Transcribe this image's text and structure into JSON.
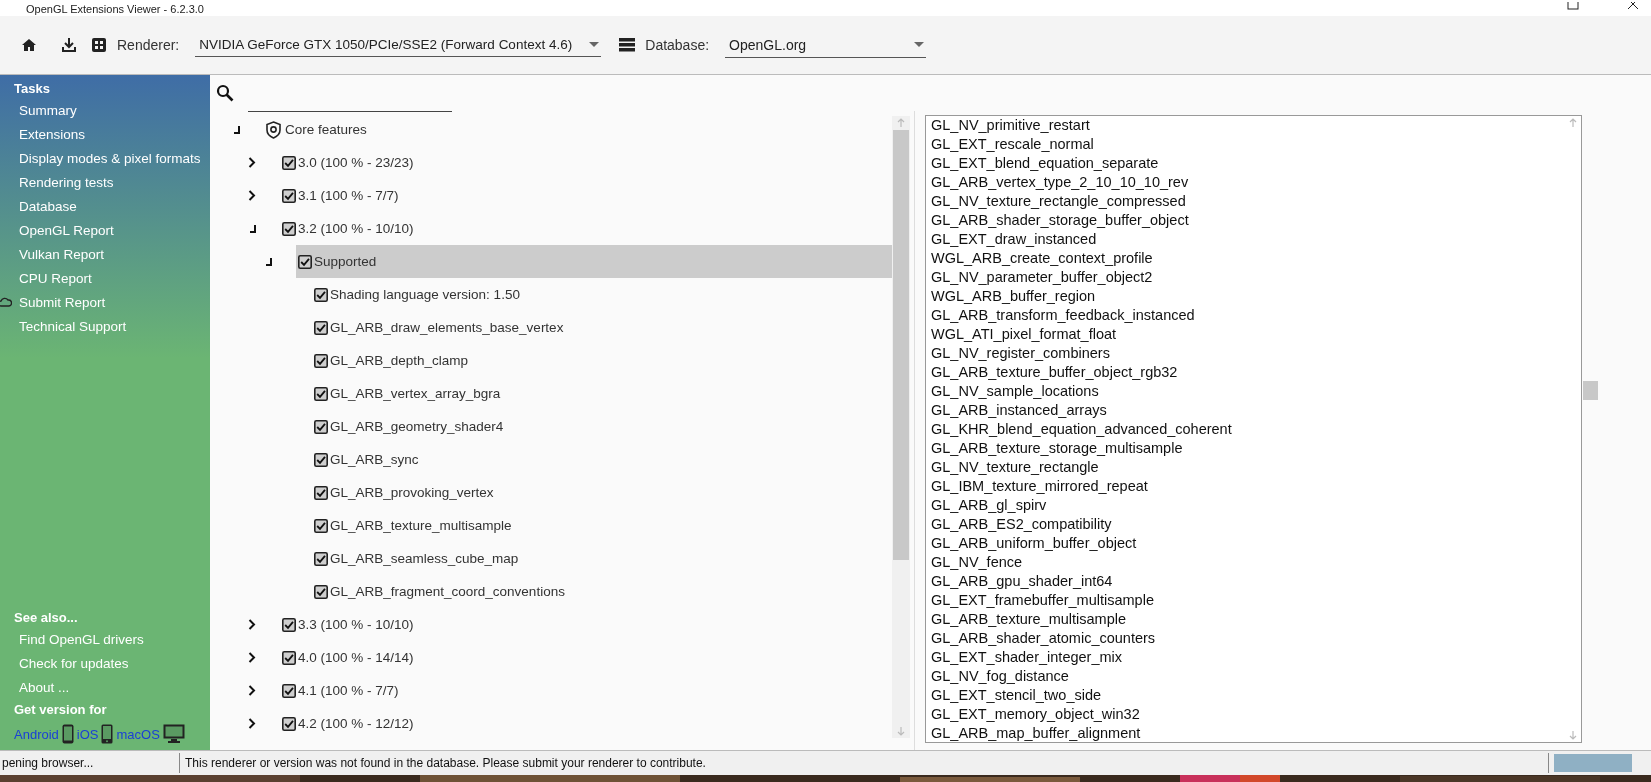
{
  "window": {
    "title": "OpenGL Extensions Viewer - 6.2.3.0"
  },
  "toolbar": {
    "renderer_label": "Renderer:",
    "renderer": "NVIDIA GeForce GTX 1050/PCIe/SSE2 (Forward Context 4.6)",
    "database_label": "Database:",
    "database": "OpenGL.org"
  },
  "sidebar": {
    "tasks_title": "Tasks",
    "tasks": [
      "Summary",
      "Extensions",
      "Display modes & pixel formats",
      "Rendering tests",
      "Database",
      "OpenGL Report",
      "Vulkan Report",
      "CPU Report",
      "Submit Report",
      "Technical Support"
    ],
    "see_also_title": "See also...",
    "see_also": [
      "Find OpenGL drivers",
      "Check for updates",
      "About ..."
    ],
    "get_version_title": "Get version for",
    "platforms": [
      "Android",
      "iOS",
      "macOS"
    ]
  },
  "tree": [
    {
      "label": "Core features",
      "kind": "category",
      "expanded": true,
      "selected": false,
      "children": [
        {
          "label": "3.0 (100 % - 23/23)",
          "kind": "check",
          "checked": true,
          "expanded": false,
          "selected": false
        },
        {
          "label": "3.1 (100 % - 7/7)",
          "kind": "check",
          "checked": true,
          "expanded": false,
          "selected": false
        },
        {
          "label": "3.2 (100 % - 10/10)",
          "kind": "check",
          "checked": true,
          "expanded": true,
          "selected": false,
          "children": [
            {
              "label": "Supported",
              "kind": "check",
              "checked": true,
              "expanded": true,
              "selected": true,
              "children": [
                {
                  "label": "Shading language version: 1.50",
                  "kind": "check",
                  "checked": true,
                  "selected": false
                },
                {
                  "label": "GL_ARB_draw_elements_base_vertex",
                  "kind": "check",
                  "checked": true,
                  "selected": false
                },
                {
                  "label": "GL_ARB_depth_clamp",
                  "kind": "check",
                  "checked": true,
                  "selected": false
                },
                {
                  "label": "GL_ARB_vertex_array_bgra",
                  "kind": "check",
                  "checked": true,
                  "selected": false
                },
                {
                  "label": "GL_ARB_geometry_shader4",
                  "kind": "check",
                  "checked": true,
                  "selected": false
                },
                {
                  "label": "GL_ARB_sync",
                  "kind": "check",
                  "checked": true,
                  "selected": false
                },
                {
                  "label": "GL_ARB_provoking_vertex",
                  "kind": "check",
                  "checked": true,
                  "selected": false
                },
                {
                  "label": "GL_ARB_texture_multisample",
                  "kind": "check",
                  "checked": true,
                  "selected": false
                },
                {
                  "label": "GL_ARB_seamless_cube_map",
                  "kind": "check",
                  "checked": true,
                  "selected": false
                },
                {
                  "label": "GL_ARB_fragment_coord_conventions",
                  "kind": "check",
                  "checked": true,
                  "selected": false
                }
              ]
            }
          ]
        },
        {
          "label": "3.3 (100 % - 10/10)",
          "kind": "check",
          "checked": true,
          "expanded": false,
          "selected": false
        },
        {
          "label": "4.0 (100 % - 14/14)",
          "kind": "check",
          "checked": true,
          "expanded": false,
          "selected": false
        },
        {
          "label": "4.1 (100 % - 7/7)",
          "kind": "check",
          "checked": true,
          "expanded": false,
          "selected": false
        },
        {
          "label": "4.2 (100 % - 12/12)",
          "kind": "check",
          "checked": true,
          "expanded": false,
          "selected": false
        }
      ]
    }
  ],
  "extensions": [
    "GL_NV_primitive_restart",
    "GL_EXT_rescale_normal",
    "GL_EXT_blend_equation_separate",
    "GL_ARB_vertex_type_2_10_10_10_rev",
    "GL_NV_texture_rectangle_compressed",
    "GL_ARB_shader_storage_buffer_object",
    "GL_EXT_draw_instanced",
    "WGL_ARB_create_context_profile",
    "GL_NV_parameter_buffer_object2",
    "WGL_ARB_buffer_region",
    "GL_ARB_transform_feedback_instanced",
    "WGL_ATI_pixel_format_float",
    "GL_NV_register_combiners",
    "GL_ARB_texture_buffer_object_rgb32",
    "GL_NV_sample_locations",
    "GL_ARB_instanced_arrays",
    "GL_KHR_blend_equation_advanced_coherent",
    "GL_ARB_texture_storage_multisample",
    "GL_NV_texture_rectangle",
    "GL_IBM_texture_mirrored_repeat",
    "GL_ARB_gl_spirv",
    "GL_ARB_ES2_compatibility",
    "GL_ARB_uniform_buffer_object",
    "GL_NV_fence",
    "GL_ARB_gpu_shader_int64",
    "GL_EXT_framebuffer_multisample",
    "GL_ARB_texture_multisample",
    "GL_ARB_shader_atomic_counters",
    "GL_EXT_shader_integer_mix",
    "GL_NV_fog_distance",
    "GL_EXT_stencil_two_side",
    "GL_EXT_memory_object_win32",
    "GL_ARB_map_buffer_alignment"
  ],
  "status_bar": {
    "left": "pening browser...",
    "message": "This renderer or version was not found in the database. Please submit your renderer to contribute.",
    "progress": {
      "level": 1
    }
  }
}
